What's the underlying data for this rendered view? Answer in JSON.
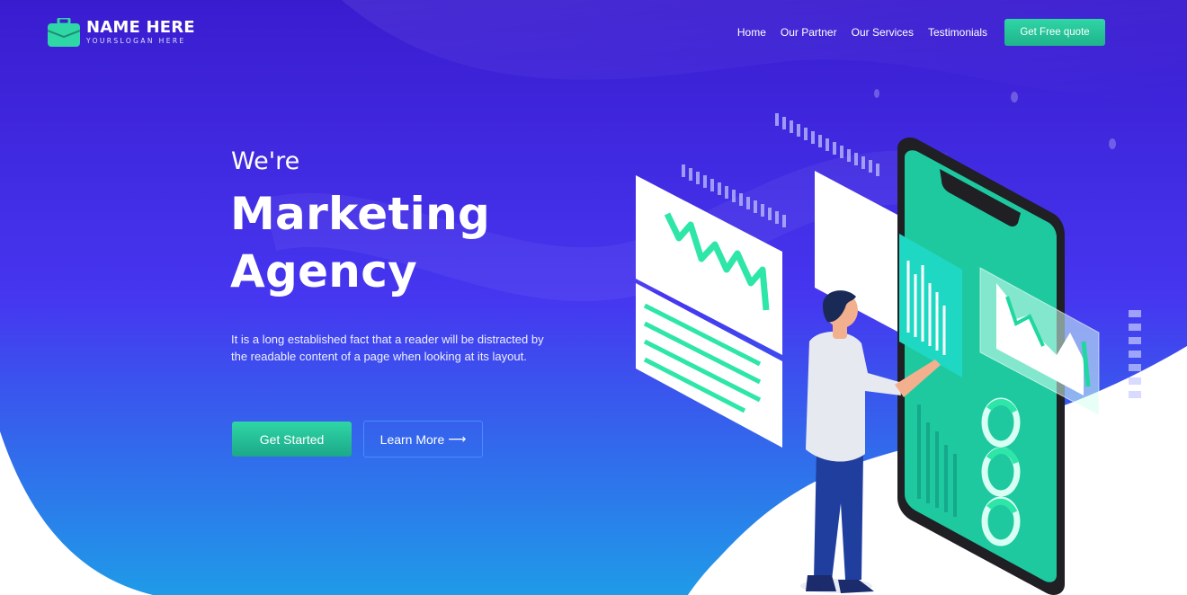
{
  "brand": {
    "name": "NAME HERE",
    "slogan": "YOURSLOGAN HERE",
    "icon": "briefcase-icon"
  },
  "nav": {
    "items": [
      "Home",
      "Our Partner",
      "Our Services",
      "Testimonials"
    ],
    "cta": "Get Free quote"
  },
  "hero": {
    "pre_title": "We're",
    "title_line1": "Marketing",
    "title_line2": "Agency",
    "description": "It is a long established fact that a reader will be distracted by the readable content of a page when looking at its layout.",
    "primary_button": "Get Started",
    "secondary_button": "Learn More",
    "secondary_icon": "arrow-right-icon"
  },
  "colors": {
    "accent": "#2fd6a6",
    "hero_top": "#3a1fd0",
    "hero_bottom": "#2a7ff0"
  }
}
